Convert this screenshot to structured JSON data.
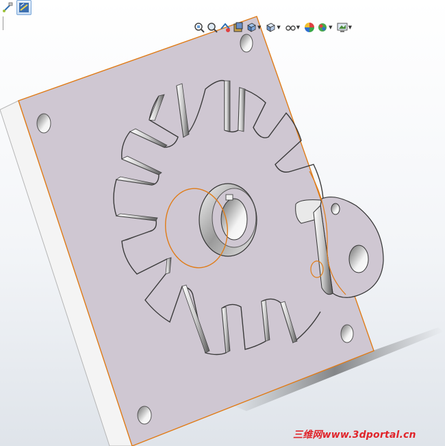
{
  "toolbar": {
    "left_tools": [
      {
        "icon": "sketch-relations-icon"
      },
      {
        "icon": "smart-dimension-icon",
        "active": true
      }
    ]
  },
  "view_toolbar": {
    "items": [
      {
        "icon": "zoom-to-fit-icon"
      },
      {
        "icon": "zoom-to-area-icon"
      },
      {
        "icon": "previous-view-icon"
      },
      {
        "icon": "section-view-icon"
      },
      {
        "icon": "view-orientation-icon",
        "dropdown": true
      },
      {
        "icon": "display-style-icon",
        "dropdown": true
      },
      {
        "icon": "hide-show-items-icon",
        "dropdown": true
      },
      {
        "icon": "edit-appearance-icon"
      },
      {
        "icon": "apply-scene-icon",
        "dropdown": true
      },
      {
        "icon": "view-settings-icon",
        "dropdown": true
      }
    ]
  },
  "model": {
    "plate_color": "#cfc7d2",
    "edge_highlight_color": "#e07b16",
    "mounting_holes": 6
  },
  "watermark": "三维网www.3dportal.cn"
}
